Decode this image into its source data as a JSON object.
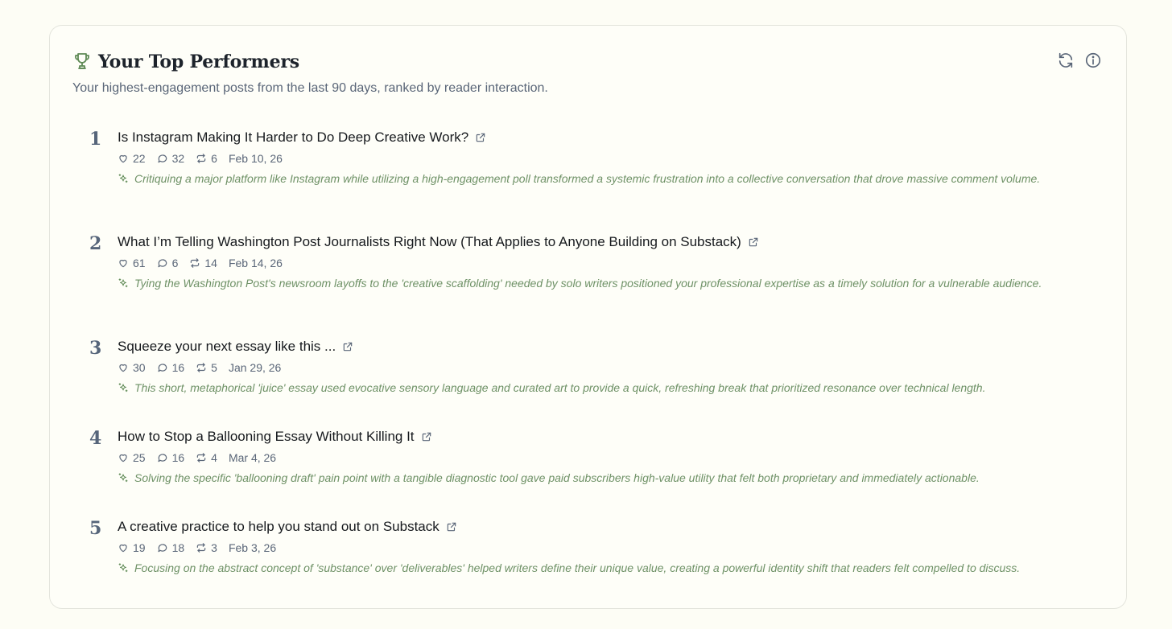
{
  "header": {
    "title": "Your Top Performers",
    "subtitle": "Your highest-engagement posts from the last 90 days, ranked by reader interaction."
  },
  "icons": {
    "trophy": "trophy-icon",
    "refresh": "refresh-icon",
    "info": "info-icon",
    "external": "external-link-icon",
    "like": "heart-icon",
    "comment": "comment-icon",
    "restack": "restack-icon",
    "insight": "sparkle-icon"
  },
  "colors": {
    "accent_green": "#5f8a55",
    "insight_text": "#6e9166",
    "muted_text": "#5a6678",
    "background": "#fdfdf5"
  },
  "posts": [
    {
      "rank": "1",
      "title": "Is Instagram Making It Harder to Do Deep Creative Work?",
      "likes": "22",
      "comments": "32",
      "restacks": "6",
      "date": "Feb 10, 26",
      "insight": "Critiquing a major platform like Instagram while utilizing a high-engagement poll transformed a systemic frustration into a collective conversation that drove massive comment volume."
    },
    {
      "rank": "2",
      "title": "What I’m Telling Washington Post Journalists Right Now (That Applies to Anyone Building on Substack)",
      "likes": "61",
      "comments": "6",
      "restacks": "14",
      "date": "Feb 14, 26",
      "insight": "Tying the Washington Post's newsroom layoffs to the 'creative scaffolding' needed by solo writers positioned your professional expertise as a timely solution for a vulnerable audience."
    },
    {
      "rank": "3",
      "title": "Squeeze your next essay like this ...",
      "likes": "30",
      "comments": "16",
      "restacks": "5",
      "date": "Jan 29, 26",
      "insight": "This short, metaphorical 'juice' essay used evocative sensory language and curated art to provide a quick, refreshing break that prioritized resonance over technical length."
    },
    {
      "rank": "4",
      "title": "How to Stop a Ballooning Essay Without Killing It",
      "likes": "25",
      "comments": "16",
      "restacks": "4",
      "date": "Mar 4, 26",
      "insight": "Solving the specific 'ballooning draft' pain point with a tangible diagnostic tool gave paid subscribers high-value utility that felt both proprietary and immediately actionable."
    },
    {
      "rank": "5",
      "title": "A creative practice to help you stand out on Substack",
      "likes": "19",
      "comments": "18",
      "restacks": "3",
      "date": "Feb 3, 26",
      "insight": "Focusing on the abstract concept of 'substance' over 'deliverables' helped writers define their unique value, creating a powerful identity shift that readers felt compelled to discuss."
    }
  ]
}
